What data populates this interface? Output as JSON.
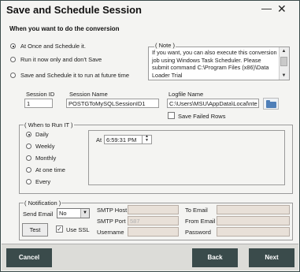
{
  "window": {
    "title": "Save and Schedule Session",
    "minimize_glyph": "—",
    "close_glyph": "✕"
  },
  "prompt": "When you want to do the conversion",
  "run_options": [
    {
      "label": "At Once and Schedule it.",
      "selected": true
    },
    {
      "label": "Run it now only and don't Save",
      "selected": false
    },
    {
      "label": "Save and Schedule it to run at future time",
      "selected": false
    }
  ],
  "note": {
    "legend": "( Note )",
    "text": "If you want, you can also execute this conversion job using Windows Task Scheduler. Please submit command C:\\Program Files (x86)\\Data Loader Trial"
  },
  "session": {
    "id_label": "Session ID",
    "id_value": "1",
    "name_label": "Session Name",
    "name_value": "POSTGToMySQLSessionID1",
    "logfile_label": "Logfile Name",
    "logfile_value": "C:\\Users\\MSU\\AppData\\Local\\nte",
    "save_failed_rows_label": "Save Failed Rows",
    "save_failed_rows_checked": false
  },
  "when_to_run": {
    "legend": "( When to Run IT )",
    "options": [
      {
        "label": "Daily",
        "selected": true
      },
      {
        "label": "Weekly",
        "selected": false
      },
      {
        "label": "Monthly",
        "selected": false
      },
      {
        "label": "At one time",
        "selected": false
      },
      {
        "label": "Every",
        "selected": false
      }
    ],
    "at_label": "At",
    "time_value": "6:59:31 PM"
  },
  "notification": {
    "legend": "( Notification )",
    "send_email_label": "Send Email",
    "send_email_value": "No",
    "test_label": "Test",
    "use_ssl_label": "Use SSL",
    "use_ssl_checked": true,
    "smtp_host_label": "SMTP Host",
    "smtp_host_value": "",
    "smtp_port_label": "SMTP Port",
    "smtp_port_value": "587",
    "username_label": "Username",
    "username_value": "",
    "to_email_label": "To Email",
    "to_email_value": "",
    "from_email_label": "From Email",
    "from_email_value": "",
    "password_label": "Password",
    "password_value": ""
  },
  "footer": {
    "cancel_label": "Cancel",
    "back_label": "Back",
    "next_label": "Next"
  },
  "icons": {
    "folder": "folder-icon",
    "scroll_up": "▲",
    "scroll_down": "▼",
    "dropdown": "▼",
    "spin_up": "▲",
    "spin_down": "▼",
    "check": "✓"
  },
  "colors": {
    "footer_button": "#3a4b4b",
    "disabled_field": "#e8e0d8",
    "folder_blue": "#4f7fb8"
  }
}
